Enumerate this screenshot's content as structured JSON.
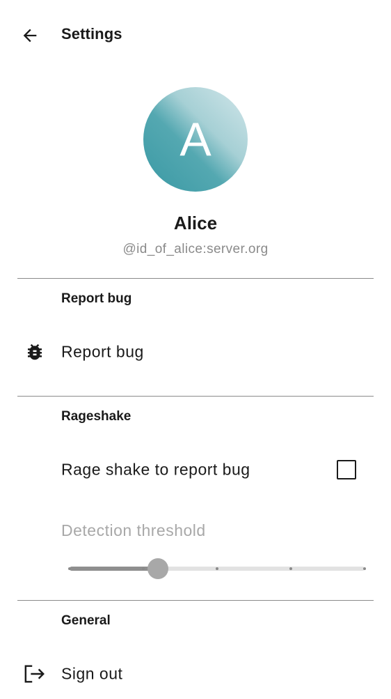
{
  "header": {
    "title": "Settings",
    "back_icon": "arrow-left-icon"
  },
  "profile": {
    "avatar_letter": "A",
    "name": "Alice",
    "user_id": "@id_of_alice:server.org",
    "avatar_colors": [
      "#d2e6ea",
      "#3a99a4"
    ]
  },
  "sections": {
    "report_bug": {
      "header": "Report bug",
      "item_label": "Report bug",
      "item_icon": "bug-icon"
    },
    "rageshake": {
      "header": "Rageshake",
      "toggle_label": "Rage shake to report bug",
      "toggle_checked": false,
      "threshold_label": "Detection threshold",
      "threshold_value": 0.3,
      "threshold_steps": 4,
      "threshold_enabled": false
    },
    "general": {
      "header": "General",
      "sign_out_label": "Sign out",
      "sign_out_icon": "sign-out-icon"
    }
  }
}
